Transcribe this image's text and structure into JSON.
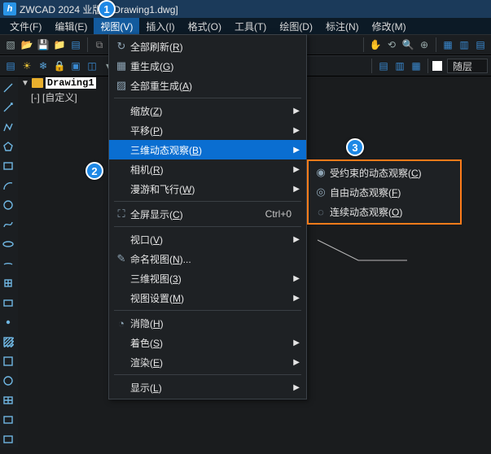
{
  "title": "ZWCAD 2024  业版 - [Drawing1.dwg]",
  "menubar": [
    "文件(F)",
    "编辑(E)",
    "视图(V)",
    "插入(I)",
    "格式(O)",
    "工具(T)",
    "绘图(D)",
    "标注(N)",
    "修改(M)"
  ],
  "menubar_active_index": 2,
  "layer_label": "随层",
  "tree": {
    "root": "Drawing1",
    "child": "[-] [自定义]"
  },
  "view_menu": [
    {
      "icon": "↻",
      "label": "全部刷新(R)",
      "arrow": false,
      "sep": false,
      "hl": false,
      "shortcut": ""
    },
    {
      "icon": "▦",
      "label": "重生成(G)",
      "arrow": false,
      "sep": false,
      "hl": false,
      "shortcut": ""
    },
    {
      "icon": "▨",
      "label": "全部重生成(A)",
      "arrow": false,
      "sep": false,
      "hl": false,
      "shortcut": ""
    },
    {
      "sep": true
    },
    {
      "icon": "",
      "label": "缩放(Z)",
      "arrow": true,
      "sep": false,
      "hl": false,
      "shortcut": ""
    },
    {
      "icon": "",
      "label": "平移(P)",
      "arrow": true,
      "sep": false,
      "hl": false,
      "shortcut": ""
    },
    {
      "icon": "",
      "label": "三维动态观察(B)",
      "arrow": true,
      "sep": false,
      "hl": true,
      "shortcut": ""
    },
    {
      "icon": "",
      "label": "相机(R)",
      "arrow": true,
      "sep": false,
      "hl": false,
      "shortcut": ""
    },
    {
      "icon": "",
      "label": "漫游和飞行(W)",
      "arrow": true,
      "sep": false,
      "hl": false,
      "shortcut": ""
    },
    {
      "sep": true
    },
    {
      "icon": "⛶",
      "label": "全屏显示(C)",
      "arrow": false,
      "sep": false,
      "hl": false,
      "shortcut": "Ctrl+0"
    },
    {
      "sep": true
    },
    {
      "icon": "",
      "label": "视口(V)",
      "arrow": true,
      "sep": false,
      "hl": false,
      "shortcut": ""
    },
    {
      "icon": "✎",
      "label": "命名视图(N)...",
      "arrow": false,
      "sep": false,
      "hl": false,
      "shortcut": ""
    },
    {
      "icon": "",
      "label": "三维视图(3)",
      "arrow": true,
      "sep": false,
      "hl": false,
      "shortcut": ""
    },
    {
      "icon": "",
      "label": "视图设置(M)",
      "arrow": true,
      "sep": false,
      "hl": false,
      "shortcut": ""
    },
    {
      "sep": true
    },
    {
      "icon": "◔",
      "label": "消隐(H)",
      "arrow": false,
      "sep": false,
      "hl": false,
      "shortcut": ""
    },
    {
      "icon": "",
      "label": "着色(S)",
      "arrow": true,
      "sep": false,
      "hl": false,
      "shortcut": ""
    },
    {
      "icon": "",
      "label": "渲染(E)",
      "arrow": true,
      "sep": false,
      "hl": false,
      "shortcut": ""
    },
    {
      "sep": true
    },
    {
      "icon": "",
      "label": "显示(L)",
      "arrow": true,
      "sep": false,
      "hl": false,
      "shortcut": ""
    }
  ],
  "submenu": [
    {
      "icon": "◉",
      "label": "受约束的动态观察(C)"
    },
    {
      "icon": "◎",
      "label": "自由动态观察(F)"
    },
    {
      "icon": "◌",
      "label": "连续动态观察(O)"
    }
  ],
  "badges": {
    "b1": "1",
    "b2": "2",
    "b3": "3"
  }
}
